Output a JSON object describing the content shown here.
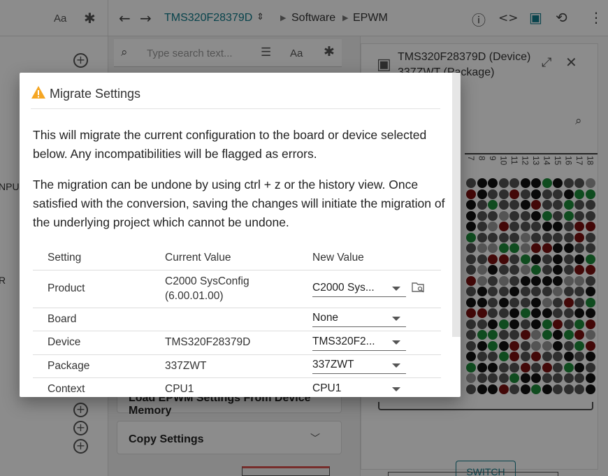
{
  "left_pane": {
    "toolbar": {
      "font_label": "Aa",
      "regex_icon": "asterisk-icon"
    },
    "edge_texts": [
      "NPU",
      "R"
    ]
  },
  "topbar": {
    "back_icon": "arrow-left-icon",
    "forward_icon": "arrow-right-icon",
    "device": "TMS320F28379D",
    "crumbs": [
      "Software",
      "EPWM"
    ],
    "icons": [
      "info-icon",
      "code-icon",
      "chip-icon",
      "history-icon",
      "more-vertical-icon"
    ]
  },
  "middle": {
    "search_placeholder": "Type search text...",
    "font_label": "Aa",
    "cards": [
      {
        "label": "Load EPWM Settings From Device Memory"
      },
      {
        "label": "Copy Settings"
      }
    ]
  },
  "right_pane": {
    "title_line1": "TMS320F28379D (Device)",
    "title_line2": "337ZWT (Package)",
    "pin_labels": [
      "7",
      "8",
      "9",
      "10",
      "11",
      "12",
      "13",
      "14",
      "15",
      "16",
      "17",
      "18"
    ],
    "switch_label": "SWITCH",
    "accent": "#0f7b8a"
  },
  "dialog": {
    "title": "Migrate Settings",
    "warning_color": "#f5a623",
    "paragraph1": "This will migrate the current configuration to the board or device selected below. Any incompatibilities will be flagged as errors.",
    "paragraph2": "The migration can be undone by using ctrl + z or the history view. Once satisfied with the conversion, saving the changes will initiate the migration of the underlying project which cannot be undone.",
    "table": {
      "headers": [
        "Setting",
        "Current Value",
        "New Value"
      ],
      "rows": [
        {
          "setting": "Product",
          "current": "C2000 SysConfig (6.00.01.00)",
          "new": "C2000 Sys..."
        },
        {
          "setting": "Board",
          "current": "",
          "new": "None"
        },
        {
          "setting": "Device",
          "current": "TMS320F28379D",
          "new": "TMS320F2..."
        },
        {
          "setting": "Package",
          "current": "337ZWT",
          "new": "337ZWT"
        },
        {
          "setting": "Context",
          "current": "CPU1",
          "new": "CPU1"
        }
      ]
    }
  }
}
